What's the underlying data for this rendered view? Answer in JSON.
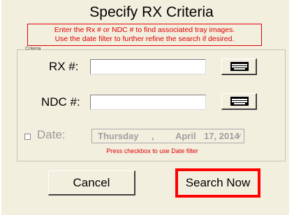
{
  "title": "Specify RX Criteria",
  "instructions": {
    "line1": "Enter the Rx # or NDC # to find associated tray images.",
    "line2": "Use the date filter to further refine the search if desired."
  },
  "criteria_group": {
    "legend": "Criteria",
    "rx": {
      "label": "RX #:",
      "value": ""
    },
    "ndc": {
      "label": "NDC #:",
      "value": ""
    },
    "date": {
      "label": "Date:",
      "checked": false,
      "weekday": "Thursday",
      "separator": ",",
      "month": "April",
      "day_year": "17, 2014",
      "enabled": false
    },
    "date_hint": "Press checkbox to use Date filter"
  },
  "buttons": {
    "cancel": "Cancel",
    "search": "Search Now"
  },
  "icons": {
    "keyboard": "keyboard-icon",
    "spin": "spin-arrow-icon"
  },
  "colors": {
    "dialog_bg": "#f3efdf",
    "warning": "#e00000",
    "highlight": "#ff0000"
  }
}
